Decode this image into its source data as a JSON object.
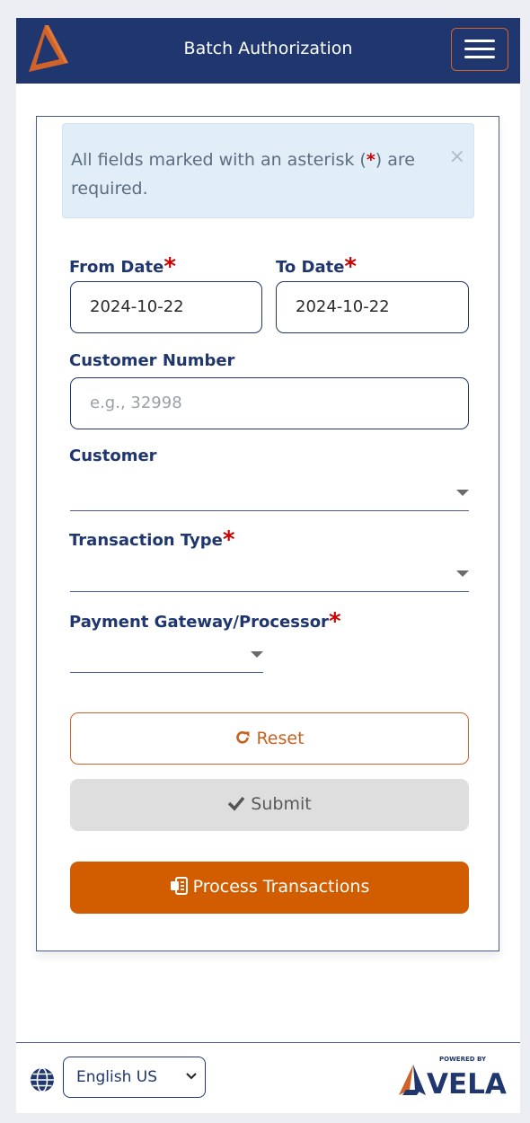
{
  "header": {
    "title": "Batch Authorization",
    "menu_icon": "hamburger-menu-icon"
  },
  "alert": {
    "text_before": "All fields marked with an asterisk (",
    "asterisk": "*",
    "text_after": ") are required.",
    "close": "×"
  },
  "form": {
    "from_date": {
      "label": "From Date",
      "required": "*",
      "value": "2024-10-22"
    },
    "to_date": {
      "label": "To Date",
      "required": "*",
      "value": "2024-10-22"
    },
    "customer_number": {
      "label": "Customer Number",
      "placeholder": "e.g., 32998"
    },
    "customer": {
      "label": "Customer",
      "value": ""
    },
    "transaction_type": {
      "label": "Transaction Type",
      "required": "*",
      "value": ""
    },
    "payment_gateway": {
      "label": "Payment Gateway/Processor",
      "required": "*",
      "value": ""
    }
  },
  "buttons": {
    "reset": "Reset",
    "submit": "Submit",
    "process": "Process Transactions"
  },
  "footer": {
    "language": "English US",
    "powered_by": "POWERED BY",
    "brand": "VELA"
  },
  "colors": {
    "navy": "#1f366e",
    "orange": "#d25c00",
    "required_red": "#cc0000",
    "alert_bg": "#e1edf7"
  }
}
